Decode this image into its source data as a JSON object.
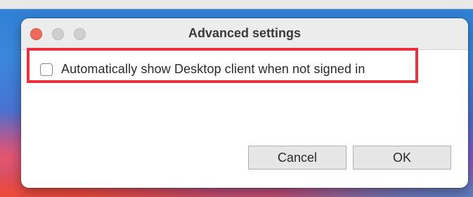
{
  "window": {
    "title": "Advanced settings",
    "controls": [
      "close",
      "minimize",
      "maximize"
    ]
  },
  "options": [
    {
      "label": "Automatically show Desktop client when not signed in",
      "checked": false
    }
  ],
  "buttons": {
    "cancel_label": "Cancel",
    "ok_label": "OK"
  },
  "colors": {
    "highlight_border": "#e8323d",
    "close_button": "#ed6a5e",
    "button_background": "#e6e6e6"
  }
}
